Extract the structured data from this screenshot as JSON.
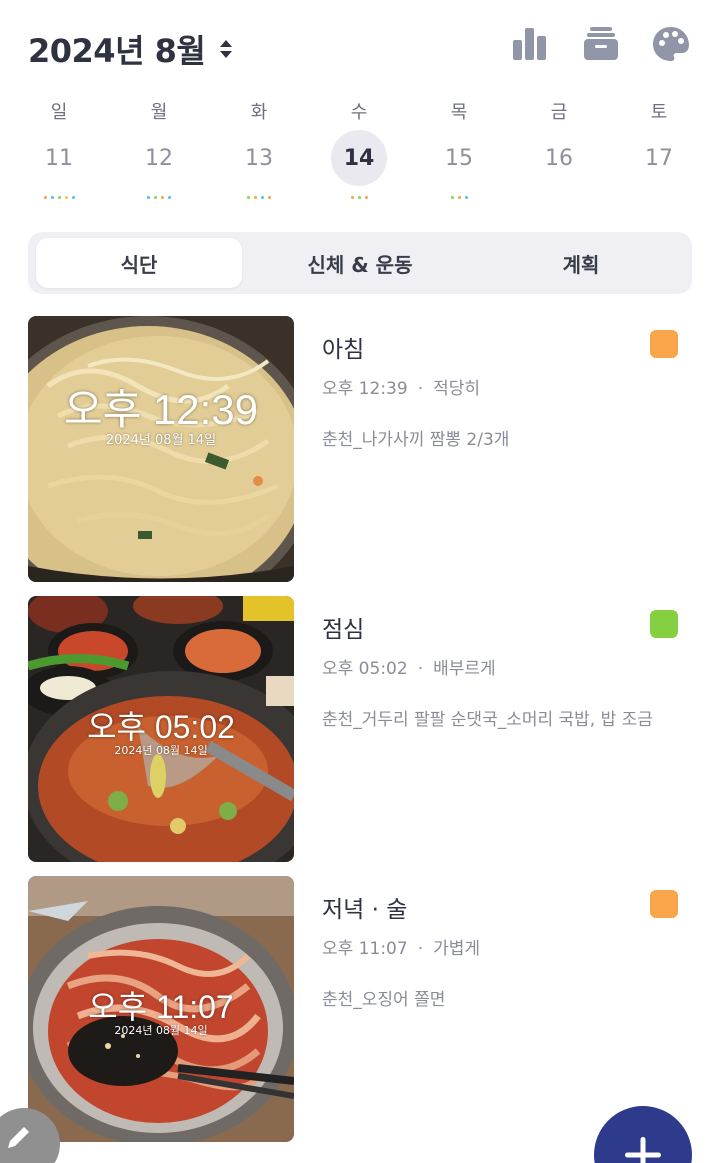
{
  "header": {
    "month_title": "2024년 8월",
    "icons": [
      "sort-icon",
      "stats-icon",
      "archive-icon",
      "palette-icon"
    ]
  },
  "week": {
    "days": [
      {
        "dow": "일",
        "date": "11",
        "dots": [
          "#f6a34a",
          "#4fc3e8",
          "#8fd14f",
          "#f6c94a",
          "#4fc3e8"
        ]
      },
      {
        "dow": "월",
        "date": "12",
        "dots": [
          "#4fc3e8",
          "#8fd14f",
          "#f6a34a",
          "#4fc3e8"
        ]
      },
      {
        "dow": "화",
        "date": "13",
        "dots": [
          "#8fd14f",
          "#f6a34a",
          "#4fc3e8",
          "#f6a34a"
        ]
      },
      {
        "dow": "수",
        "date": "14",
        "dots": [
          "#f6a34a",
          "#8fd14f",
          "#f6a34a"
        ],
        "selected": true
      },
      {
        "dow": "목",
        "date": "15",
        "dots": [
          "#8fd14f",
          "#f6a34a",
          "#4fc3e8"
        ]
      },
      {
        "dow": "금",
        "date": "16",
        "dots": []
      },
      {
        "dow": "토",
        "date": "17",
        "dots": []
      }
    ]
  },
  "tabs": [
    {
      "label": "식단",
      "active": true
    },
    {
      "label": "신체 & 운동",
      "active": false
    },
    {
      "label": "계획",
      "active": false
    }
  ],
  "meals": [
    {
      "title": "아침",
      "time": "오후 12:39",
      "fullness": "적당히",
      "description": "춘천_나가사끼 짬뽕 2/3개",
      "badge_color": "#f9a54a",
      "photo_stamp_time": "오후 12:39",
      "photo_stamp_date": "2024년 08월 14일"
    },
    {
      "title": "점심",
      "time": "오후 05:02",
      "fullness": "배부르게",
      "description": "춘천_거두리 팔팔 순댓국_소머리 국밥, 밥 조금",
      "badge_color": "#84d040",
      "photo_stamp_time": "오후 05:02",
      "photo_stamp_date": "2024년 08월 14일"
    },
    {
      "title": "저녁 · 술",
      "time": "오후 11:07",
      "fullness": "가볍게",
      "description": "춘천_오징어 쫄면",
      "badge_color": "#f9a54a",
      "photo_stamp_time": "오후 11:07",
      "photo_stamp_date": "2024년 08월 14일"
    }
  ],
  "fabs": {
    "edit_icon": "pencil-icon",
    "add_icon": "plus-icon"
  }
}
